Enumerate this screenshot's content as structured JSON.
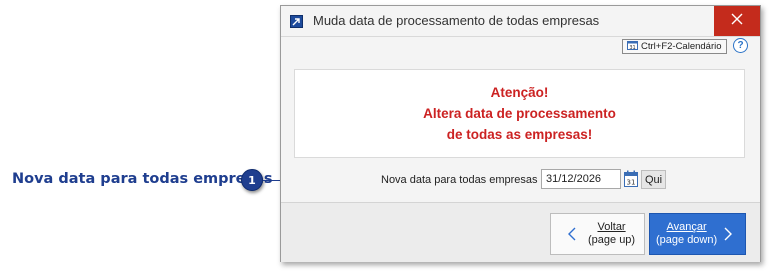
{
  "callout": {
    "label": "Nova data para todas empresas",
    "number": "1"
  },
  "dialog": {
    "title": "Muda data de processamento de todas empresas",
    "calendar_shortcut": "Ctrl+F2-Calendário",
    "help": "?",
    "warning": {
      "line1": "Atenção!",
      "line2": "Altera data de processamento",
      "line3": "de todas as empresas!"
    },
    "date_field": {
      "label": "Nova data para todas empresas",
      "value": "31/12/2026",
      "weekday": "Qui"
    },
    "buttons": {
      "back_label": "Voltar",
      "back_hint": "(page up)",
      "next_label": "Avançar",
      "next_hint": "(page down)"
    }
  },
  "colors": {
    "accent": "#1f3e8f",
    "warning_text": "#cc2222",
    "close_button": "#c42b1c",
    "primary_button": "#2f6fd0"
  },
  "icons": [
    "app-icon",
    "close-icon",
    "calendar-icon",
    "help-icon",
    "chevron-left-icon",
    "chevron-right-icon"
  ]
}
